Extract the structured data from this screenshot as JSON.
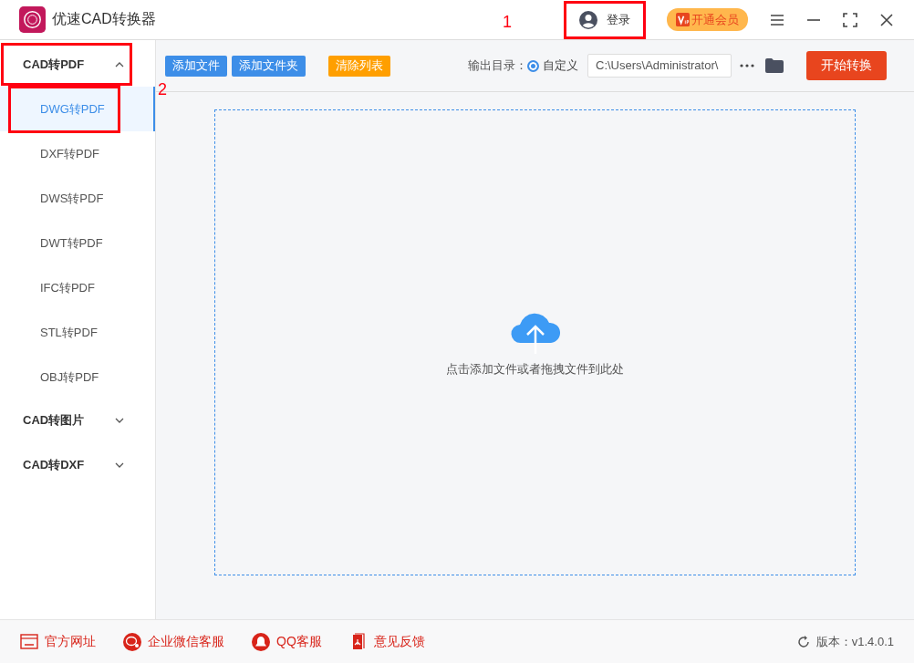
{
  "window": {
    "title": "优速CAD转换器"
  },
  "header": {
    "login": {
      "label": "登录",
      "highlighted": true,
      "callout": "1"
    },
    "vip": {
      "label": "开通会员"
    }
  },
  "toolbar": {
    "buttons": [
      {
        "label": "添加文件",
        "kind": "primary"
      },
      {
        "label": "添加文件夹",
        "kind": "primary"
      },
      {
        "label": "清除列表",
        "kind": "warning"
      }
    ],
    "output_label": "输出目录：",
    "output_option": {
      "label": "自定义",
      "selected": true
    },
    "output_path": "C:\\Users\\Administrator\\",
    "start": "开始转换"
  },
  "sidebar": {
    "groups": [
      {
        "label": "CAD转PDF",
        "expanded": true,
        "highlighted": true,
        "children": [
          {
            "label": "DWG转PDF",
            "selected": true,
            "highlighted": true,
            "callout": "2"
          },
          {
            "label": "DXF转PDF",
            "selected": false,
            "highlighted": false
          },
          {
            "label": "DWS转PDF",
            "selected": false,
            "highlighted": false
          },
          {
            "label": "DWT转PDF",
            "selected": false,
            "highlighted": false
          },
          {
            "label": "IFC转PDF",
            "selected": false,
            "highlighted": false
          },
          {
            "label": "STL转PDF",
            "selected": false,
            "highlighted": false
          },
          {
            "label": "OBJ转PDF",
            "selected": false,
            "highlighted": false
          }
        ]
      },
      {
        "label": "CAD转图片",
        "expanded": false,
        "highlighted": false
      },
      {
        "label": "CAD转DXF",
        "expanded": false,
        "highlighted": false
      }
    ]
  },
  "dropzone": {
    "hint": "点击添加文件或者拖拽文件到此处"
  },
  "footer": {
    "links": [
      {
        "label": "官方网址",
        "kind": "web"
      },
      {
        "label": "企业微信客服",
        "kind": "wechat"
      },
      {
        "label": "QQ客服",
        "kind": "qq"
      },
      {
        "label": "意见反馈",
        "kind": "feedback"
      }
    ],
    "version": "版本：v1.4.0.1"
  }
}
